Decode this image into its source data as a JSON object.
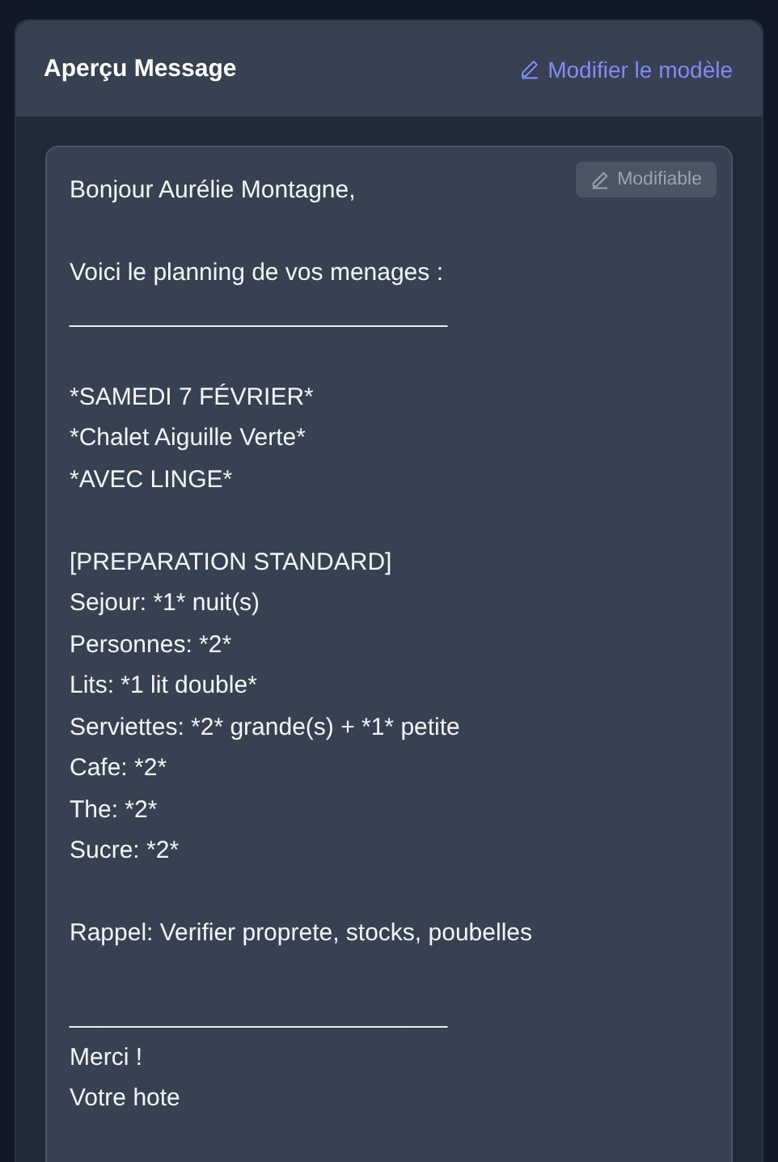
{
  "panel": {
    "title": "Aperçu Message",
    "edit_link": "Modifier le modèle"
  },
  "message": {
    "badge": "Modifiable",
    "lines": [
      {
        "kind": "text",
        "text": "Bonjour Aurélie Montagne,"
      },
      {
        "kind": "blank"
      },
      {
        "kind": "text",
        "text": "Voici le planning de vos menages :"
      },
      {
        "kind": "text",
        "text": "____________________________"
      },
      {
        "kind": "blank"
      },
      {
        "kind": "text",
        "text": "*SAMEDI 7 FÉVRIER*"
      },
      {
        "kind": "text",
        "text": "*Chalet Aiguille Verte*"
      },
      {
        "kind": "text",
        "text": "*AVEC LINGE*"
      },
      {
        "kind": "blank"
      },
      {
        "kind": "text",
        "text": "[PREPARATION STANDARD]"
      },
      {
        "kind": "text",
        "text": "Sejour: *1* nuit(s)"
      },
      {
        "kind": "text",
        "text": "Personnes: *2*"
      },
      {
        "kind": "text",
        "text": "Lits: *1 lit double*"
      },
      {
        "kind": "text",
        "text": "Serviettes: *2* grande(s) + *1* petite"
      },
      {
        "kind": "text",
        "text": "Cafe: *2*"
      },
      {
        "kind": "text",
        "text": "The: *2*"
      },
      {
        "kind": "text",
        "text": "Sucre: *2*"
      },
      {
        "kind": "blank"
      },
      {
        "kind": "text",
        "text": "Rappel: Verifier proprete, stocks, poubelles"
      },
      {
        "kind": "blank"
      },
      {
        "kind": "text",
        "text": "____________________________"
      },
      {
        "kind": "text",
        "text": "Merci !"
      },
      {
        "kind": "text",
        "text": "Votre hote"
      }
    ]
  }
}
